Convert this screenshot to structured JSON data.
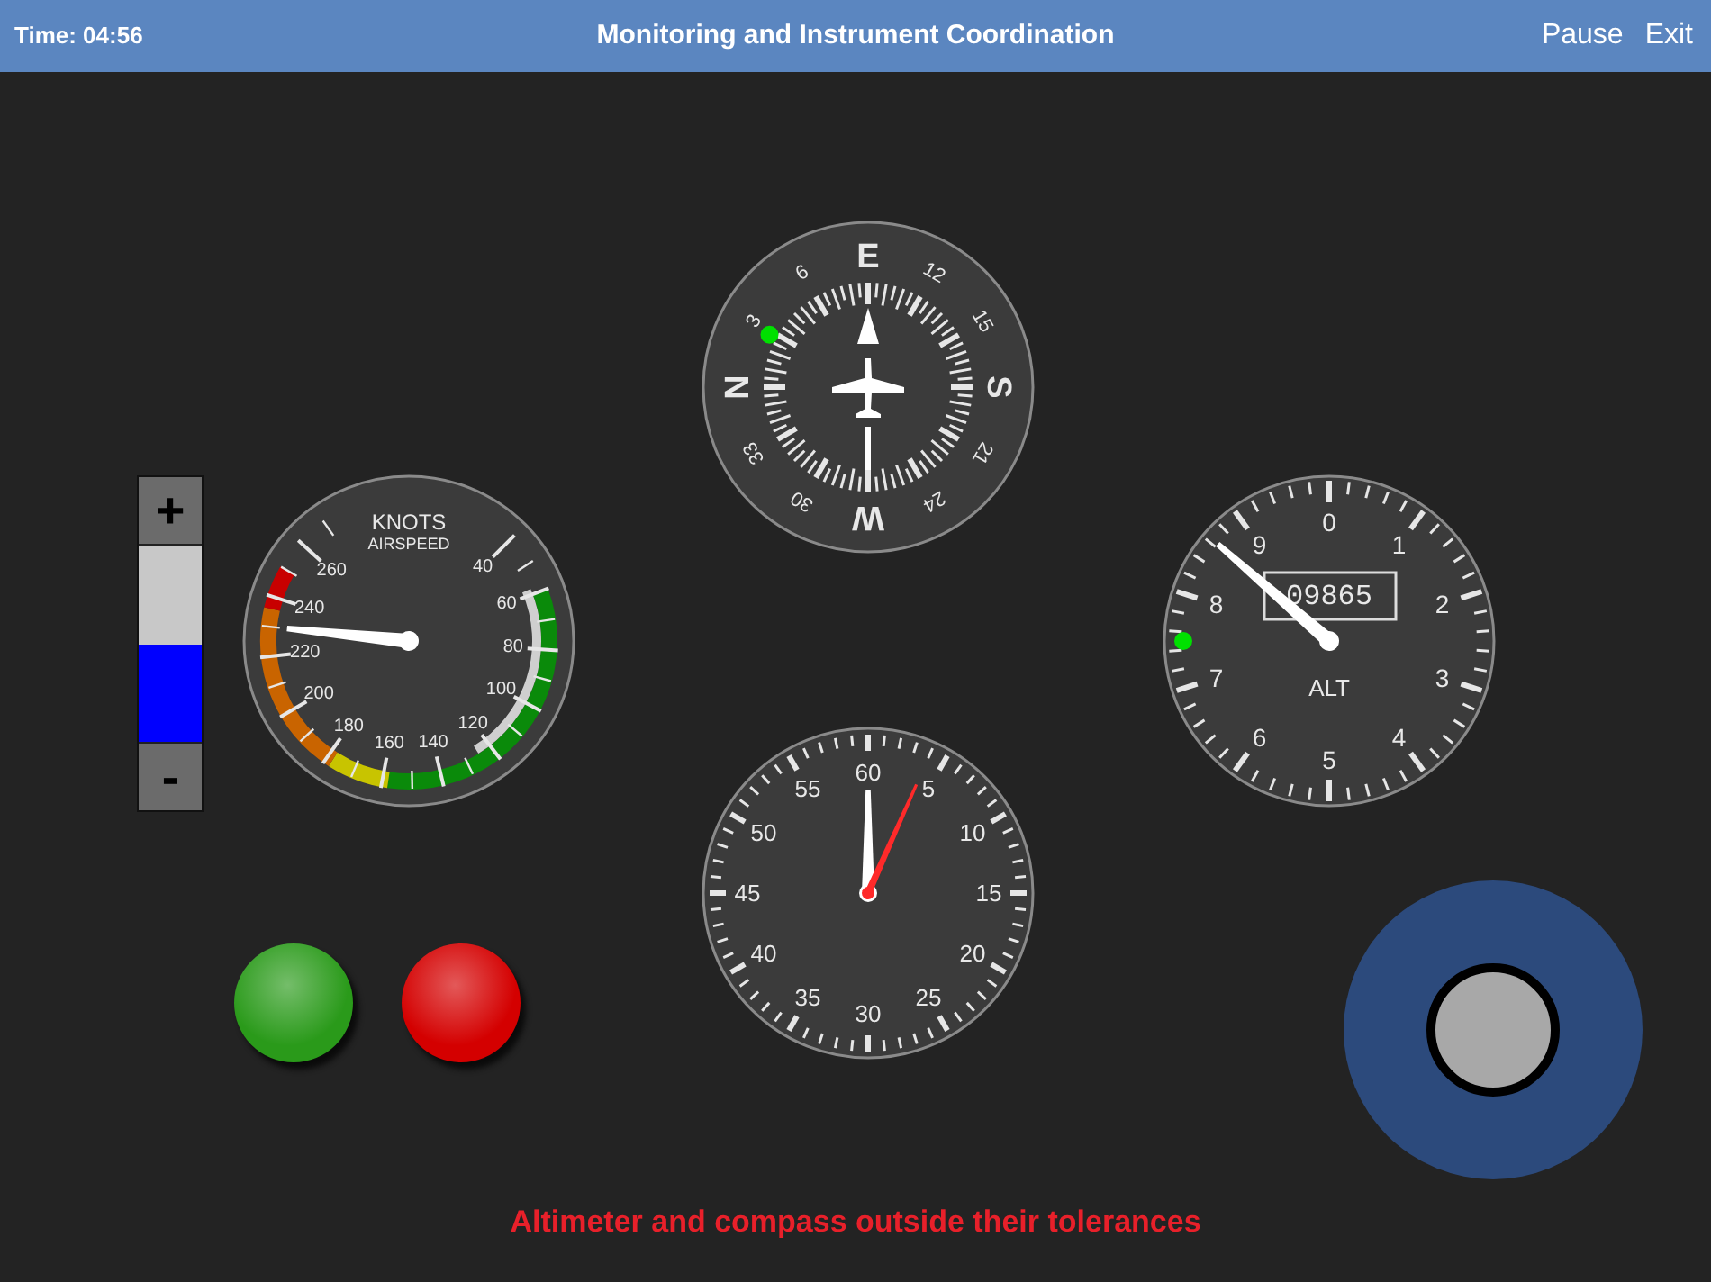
{
  "header": {
    "time": "Time: 04:56",
    "title": "Monitoring and Instrument Coordination",
    "actions": [
      "Pause",
      "Exit"
    ]
  },
  "throttle": {
    "plus": "+",
    "minus": "-",
    "level": 0.5
  },
  "airspeed": {
    "unit": "KNOTS",
    "caption": "AIRSPEED",
    "scale": [
      "40",
      "60",
      "80",
      "100",
      "120",
      "140",
      "160",
      "180",
      "200",
      "220",
      "240",
      "260"
    ]
  },
  "compass": {
    "scale": [
      "N",
      "3",
      "6",
      "E",
      "12",
      "15",
      "S",
      "21",
      "24",
      "W",
      "30",
      "33"
    ]
  },
  "altimeter": {
    "scale": [
      "0",
      "1",
      "2",
      "3",
      "4",
      "5",
      "6",
      "7",
      "8",
      "9"
    ],
    "readout": "09865",
    "caption": "ALT"
  },
  "timer": {
    "scale": [
      "60",
      "5",
      "10",
      "15",
      "20",
      "25",
      "30",
      "35",
      "40",
      "45",
      "50",
      "55"
    ]
  },
  "buttons": [
    {
      "color": "#2a9a1a"
    },
    {
      "color": "#d40000"
    }
  ],
  "message": "Altimeter and compass outside their tolerances"
}
